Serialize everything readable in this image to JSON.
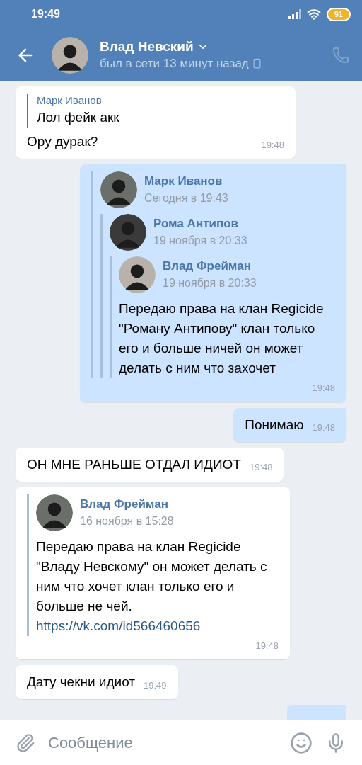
{
  "status_bar": {
    "time": "19:49",
    "battery": "91"
  },
  "header": {
    "name": "Влад Невский",
    "status": "был в сети 13 минут назад"
  },
  "messages": [
    {
      "kind": "reply",
      "outgoing": false,
      "quote_author": "Марк Иванов",
      "quote_text": "Лол фейк акк",
      "text": "Ору дурак?",
      "time": "19:48"
    },
    {
      "kind": "forward",
      "outgoing": true,
      "forwards": [
        {
          "author": "Марк Иванов",
          "date": "Сегодня в 19:43"
        },
        {
          "author": "Рома Антипов",
          "date": "19 ноября в 20:33"
        },
        {
          "author": "Влад Фрейман",
          "date": "19 ноября в 20:33"
        }
      ],
      "text": "Передаю права на клан Regicide \"Роману Антипову\" клан только его и больше ничей он может делать с ним что захочет",
      "time": "19:48"
    },
    {
      "kind": "text",
      "outgoing": true,
      "text": "Понимаю",
      "time": "19:48"
    },
    {
      "kind": "text",
      "outgoing": false,
      "text": "ОН МНЕ РАНЬШЕ ОТДАЛ ИДИОТ",
      "time": "19:48"
    },
    {
      "kind": "forward",
      "outgoing": false,
      "forwards": [
        {
          "author": "Влад Фрейман",
          "date": "16 ноября в 15:28"
        }
      ],
      "text": "Передаю права на клан Regicide \"Владу Невскому\" он может делать с ним что хочет клан только его и больше не чей.",
      "link": "https://vk.com/id566460656",
      "time": "19:48"
    },
    {
      "kind": "text",
      "outgoing": false,
      "text": "Дату чекни идиот",
      "time": "19:49"
    },
    {
      "kind": "cut",
      "outgoing": true
    }
  ],
  "composer": {
    "placeholder": "Сообщение"
  }
}
